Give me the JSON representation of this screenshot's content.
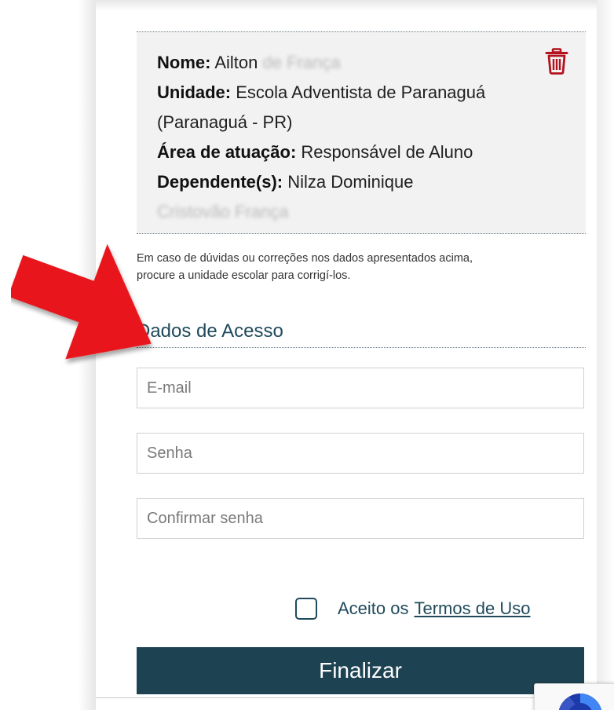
{
  "user_info": {
    "name_label": "Nome:",
    "name_value": "Ailton",
    "unit_label": "Unidade:",
    "unit_value_line1": "Escola Adventista de Paranaguá",
    "unit_value_line2": "(Paranaguá - PR)",
    "area_label": "Área de atuação:",
    "area_value": "Responsável de Aluno",
    "dependents_label": "Dependente(s):",
    "dependents_value": "Nilza Dominique"
  },
  "help_text_line1": "Em caso de dúvidas ou correções nos dados apresentados acima,",
  "help_text_line2": "procure a unidade escolar para corrigí-los.",
  "access_section": {
    "title": "Dados de Acesso",
    "email_placeholder": "E-mail",
    "password_placeholder": "Senha",
    "confirm_password_placeholder": "Confirmar senha"
  },
  "terms": {
    "accept_text": "Aceito os",
    "link_text": "Termos de Uso",
    "checked": false
  },
  "submit_label": "Finalizar",
  "icons": {
    "delete": "trash-icon",
    "annotation": "red-arrow-icon",
    "captcha": "recaptcha-icon"
  },
  "colors": {
    "primary": "#1d4353",
    "accent_text": "#1f4a5b",
    "delete_icon": "#b3121d",
    "arrow": "#e8121a",
    "info_background": "#f2f2f2"
  }
}
